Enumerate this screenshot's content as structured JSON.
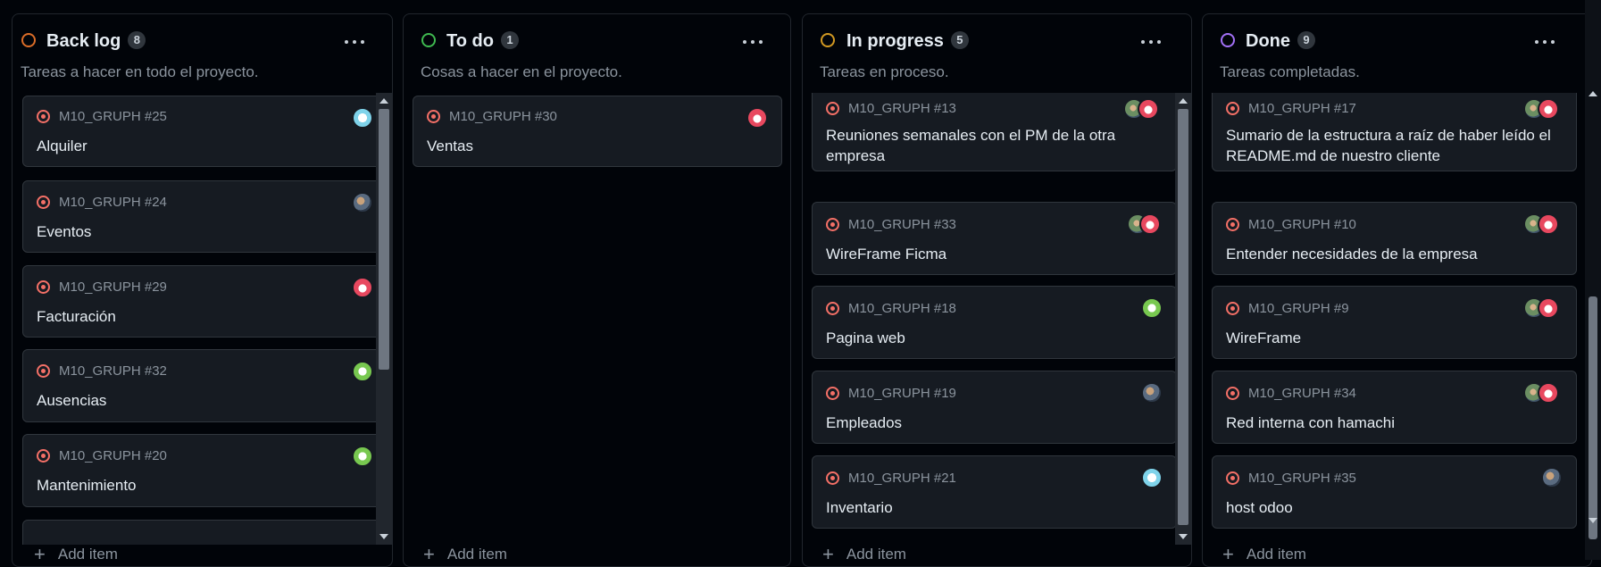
{
  "columns": [
    {
      "title": "Back log",
      "count": "8",
      "description": "Tareas a hacer en todo el proyecto.",
      "status_color": "#db6d28",
      "add_label": "Add item",
      "cards": [
        {
          "ref": "M10_GRUPH #25",
          "title": "Alquiler",
          "avatar": "cyan-identicon-avatar"
        },
        {
          "ref": "M10_GRUPH #24",
          "title": "Eventos",
          "avatar": "photo-avatar"
        },
        {
          "ref": "M10_GRUPH #29",
          "title": "Facturación",
          "avatar": "red-identicon-avatar"
        },
        {
          "ref": "M10_GRUPH #32",
          "title": "Ausencias",
          "avatar": "green-identicon-avatar"
        },
        {
          "ref": "M10_GRUPH #20",
          "title": "Mantenimiento",
          "avatar": "green-identicon-avatar"
        }
      ]
    },
    {
      "title": "To do",
      "count": "1",
      "description": "Cosas a hacer en el proyecto.",
      "status_color": "#3fb950",
      "add_label": "Add item",
      "cards": [
        {
          "ref": "M10_GRUPH #30",
          "title": "Ventas",
          "avatar": "red-identicon-avatar"
        }
      ]
    },
    {
      "title": "In progress",
      "count": "5",
      "description": "Tareas en proceso.",
      "status_color": "#d29922",
      "add_label": "Add item",
      "cards": [
        {
          "ref": "M10_GRUPH #13",
          "title": "Reuniones semanales con el PM de la otra empresa",
          "avatar": "multi-avatar-stack"
        },
        {
          "ref": "M10_GRUPH #33",
          "title": "WireFrame Ficma",
          "avatar": "multi-avatar-stack"
        },
        {
          "ref": "M10_GRUPH #18",
          "title": "Pagina web",
          "avatar": "green-identicon-avatar"
        },
        {
          "ref": "M10_GRUPH #19",
          "title": "Empleados",
          "avatar": "photo-avatar"
        },
        {
          "ref": "M10_GRUPH #21",
          "title": "Inventario",
          "avatar": "cyan-identicon-avatar"
        }
      ]
    },
    {
      "title": "Done",
      "count": "9",
      "description": "Tareas completadas.",
      "status_color": "#a371f7",
      "add_label": "Add item",
      "cards": [
        {
          "ref": "M10_GRUPH #17",
          "title": "Sumario de la estructura a raíz de haber leído el README.md de nuestro cliente",
          "avatar": "multi-avatar-stack"
        },
        {
          "ref": "M10_GRUPH #10",
          "title": "Entender necesidades de la empresa",
          "avatar": "multi-avatar-stack"
        },
        {
          "ref": "M10_GRUPH #9",
          "title": "WireFrame",
          "avatar": "multi-avatar-stack"
        },
        {
          "ref": "M10_GRUPH #34",
          "title": "Red interna con hamachi",
          "avatar": "multi-avatar-stack"
        },
        {
          "ref": "M10_GRUPH #35",
          "title": "host odoo",
          "avatar": "photo-avatar"
        }
      ]
    }
  ],
  "colors": {
    "background": "#010409",
    "card": "#161b22",
    "issue_icon": "#f47067"
  }
}
